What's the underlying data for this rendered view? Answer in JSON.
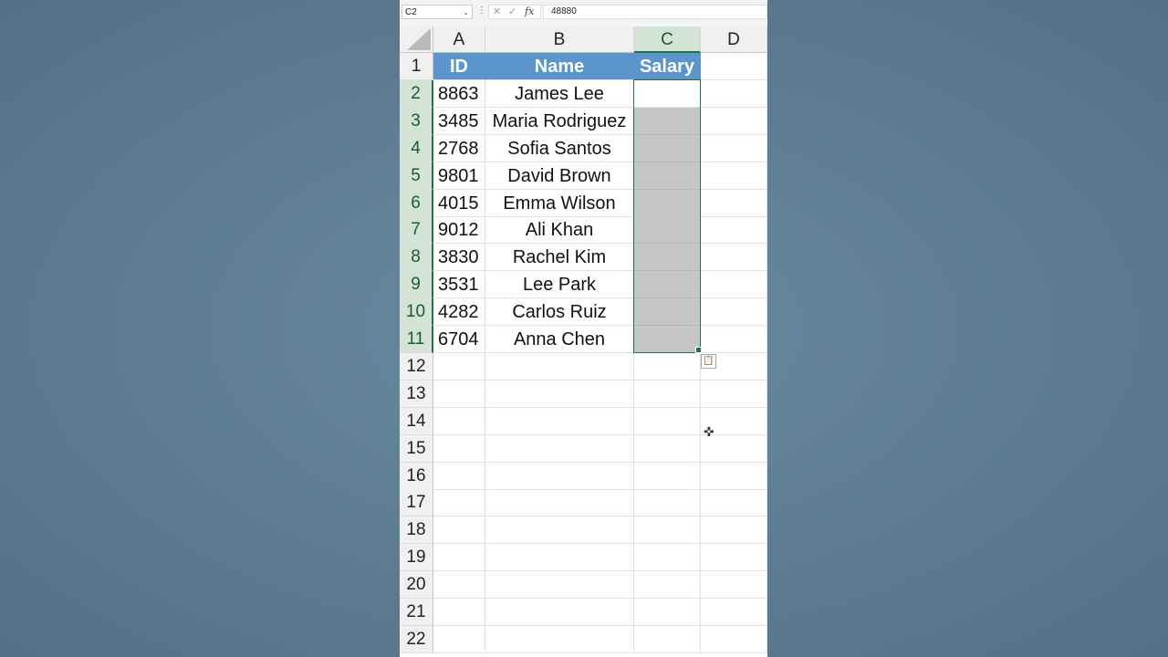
{
  "formula_bar": {
    "name_box": "C2",
    "name_box_arrow": "⌄",
    "more_icon": "⋮",
    "cancel_icon": "✕",
    "enter_icon": "✓",
    "function_icon": "fx",
    "formula_value": "48880"
  },
  "columns": [
    {
      "letter": "A",
      "selected": false
    },
    {
      "letter": "B",
      "selected": false
    },
    {
      "letter": "C",
      "selected": true
    },
    {
      "letter": "D",
      "selected": false
    }
  ],
  "table_header": {
    "a": "ID",
    "b": "Name",
    "c": "Salary"
  },
  "data_rows": [
    {
      "id": "8863",
      "name": "James Lee"
    },
    {
      "id": "3485",
      "name": "Maria Rodriguez"
    },
    {
      "id": "2768",
      "name": "Sofia Santos"
    },
    {
      "id": "9801",
      "name": "David Brown"
    },
    {
      "id": "4015",
      "name": "Emma Wilson"
    },
    {
      "id": "9012",
      "name": "Ali Khan"
    },
    {
      "id": "3830",
      "name": "Rachel Kim"
    },
    {
      "id": "3531",
      "name": "Lee Park"
    },
    {
      "id": "4282",
      "name": "Carlos Ruiz"
    },
    {
      "id": "6704",
      "name": "Anna Chen"
    }
  ],
  "row_numbers": [
    "1",
    "2",
    "3",
    "4",
    "5",
    "6",
    "7",
    "8",
    "9",
    "10",
    "11",
    "12",
    "13",
    "14",
    "15",
    "16",
    "17",
    "18",
    "19",
    "20",
    "21",
    "22"
  ],
  "selected_rows": [
    "2",
    "3",
    "4",
    "5",
    "6",
    "7",
    "8",
    "9",
    "10",
    "11"
  ],
  "paste_options_icon": "📋",
  "cursor_icon": "✜",
  "colors": {
    "header_fill": "#5b95cc",
    "selection_fill": "#c6c6c6",
    "selection_border": "#217346",
    "background": "#5f7f97"
  }
}
